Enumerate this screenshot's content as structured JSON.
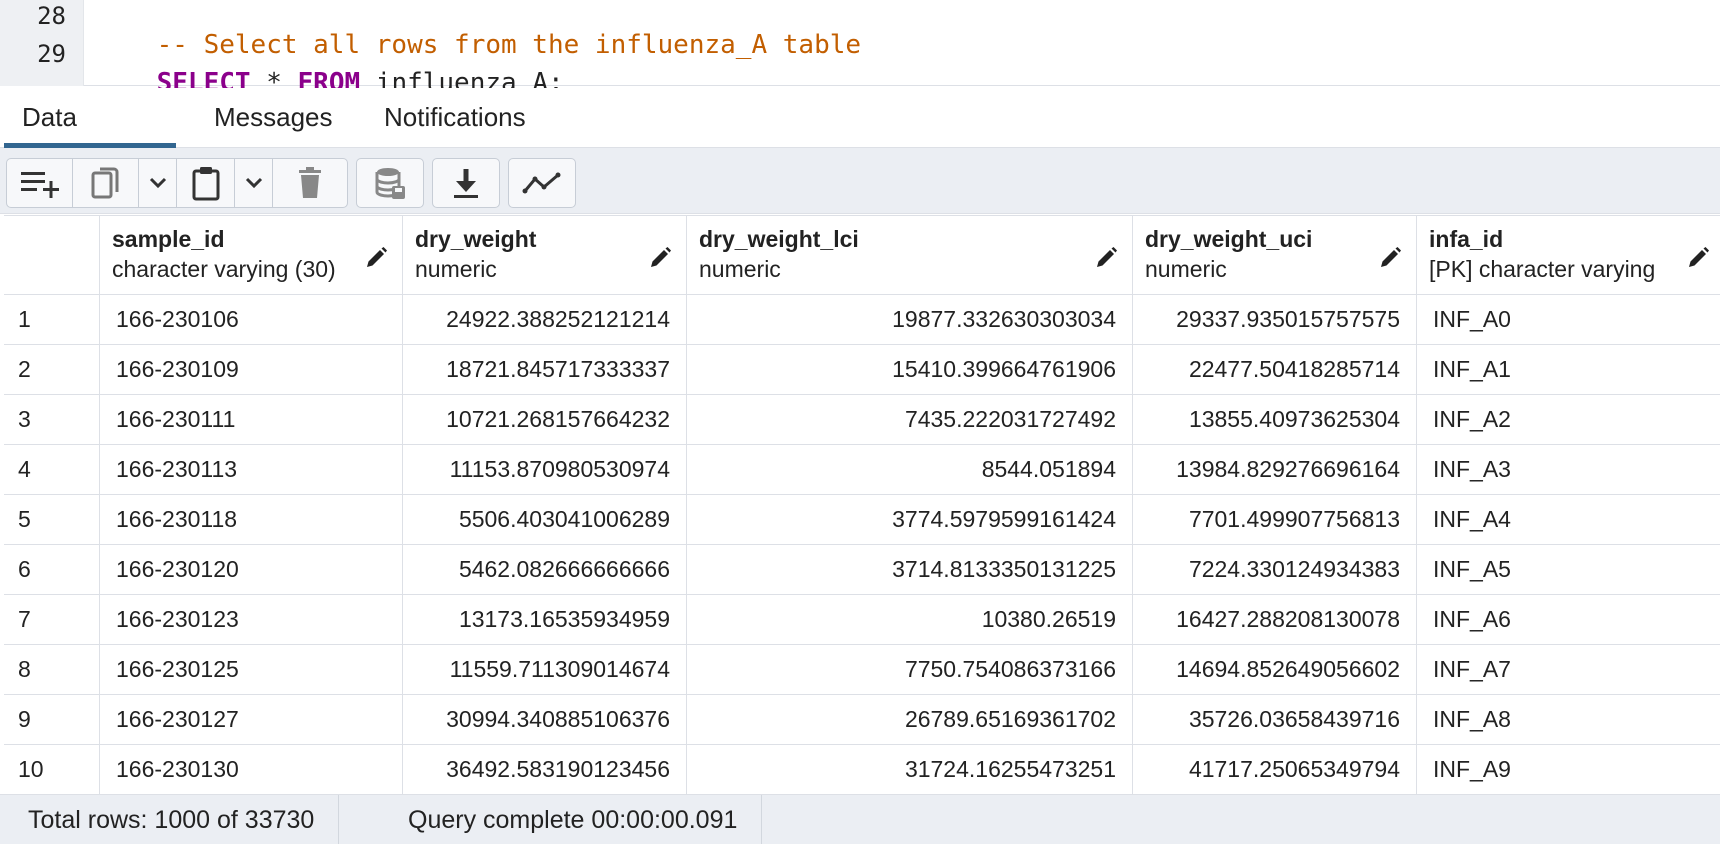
{
  "editor": {
    "lines": [
      {
        "number": "28",
        "parts": [
          {
            "text": "-- Select all rows from the influenza_A table"
          }
        ]
      },
      {
        "number": "29",
        "parts": [
          {
            "text": "SELECT"
          },
          {
            "text": " * "
          },
          {
            "text": "FROM"
          },
          {
            "text": " influenza_A;"
          }
        ]
      }
    ]
  },
  "tabs": [
    {
      "label": "Data Output",
      "active": true
    },
    {
      "label": "Messages",
      "active": false
    },
    {
      "label": "Notifications",
      "active": false
    }
  ],
  "toolbar": {
    "icons": [
      "add-row-icon",
      "copy-icon",
      "chevron-down-icon",
      "paste-icon",
      "chevron-down-icon",
      "delete-icon",
      "save-data-icon",
      "download-icon",
      "graph-visualiser-icon"
    ]
  },
  "grid": {
    "columns": [
      {
        "name": "",
        "type": ""
      },
      {
        "name": "sample_id",
        "type": "character varying (30)"
      },
      {
        "name": "dry_weight",
        "type": "numeric"
      },
      {
        "name": "dry_weight_lci",
        "type": "numeric"
      },
      {
        "name": "dry_weight_uci",
        "type": "numeric"
      },
      {
        "name": "infa_id",
        "type": "[PK] character varying"
      }
    ],
    "rows": [
      [
        "1",
        "166-230106",
        "24922.388252121214",
        "19877.332630303034",
        "29337.935015757575",
        "INF_A0"
      ],
      [
        "2",
        "166-230109",
        "18721.845717333337",
        "15410.399664761906",
        "22477.50418285714",
        "INF_A1"
      ],
      [
        "3",
        "166-230111",
        "10721.268157664232",
        "7435.222031727492",
        "13855.40973625304",
        "INF_A2"
      ],
      [
        "4",
        "166-230113",
        "11153.870980530974",
        "8544.051894",
        "13984.829276696164",
        "INF_A3"
      ],
      [
        "5",
        "166-230118",
        "5506.403041006289",
        "3774.5979599161424",
        "7701.499907756813",
        "INF_A4"
      ],
      [
        "6",
        "166-230120",
        "5462.082666666666",
        "3714.8133350131225",
        "7224.330124934383",
        "INF_A5"
      ],
      [
        "7",
        "166-230123",
        "13173.16535934959",
        "10380.26519",
        "16427.288208130078",
        "INF_A6"
      ],
      [
        "8",
        "166-230125",
        "11559.711309014674",
        "7750.754086373166",
        "14694.852649056602",
        "INF_A7"
      ],
      [
        "9",
        "166-230127",
        "30994.340885106376",
        "26789.65169361702",
        "35726.03658439716",
        "INF_A8"
      ],
      [
        "10",
        "166-230130",
        "36492.583190123456",
        "31724.16255473251",
        "41717.25065349794",
        "INF_A9"
      ]
    ]
  },
  "status": {
    "total_rows": "Total rows: 1000 of 33730",
    "query_complete": "Query complete 00:00:00.091"
  },
  "colors": {
    "accent": "#326690",
    "comment": "#c25e00",
    "keyword": "#8b008b",
    "toolbar_bg": "#ebeef3",
    "border": "#dde0e6"
  }
}
